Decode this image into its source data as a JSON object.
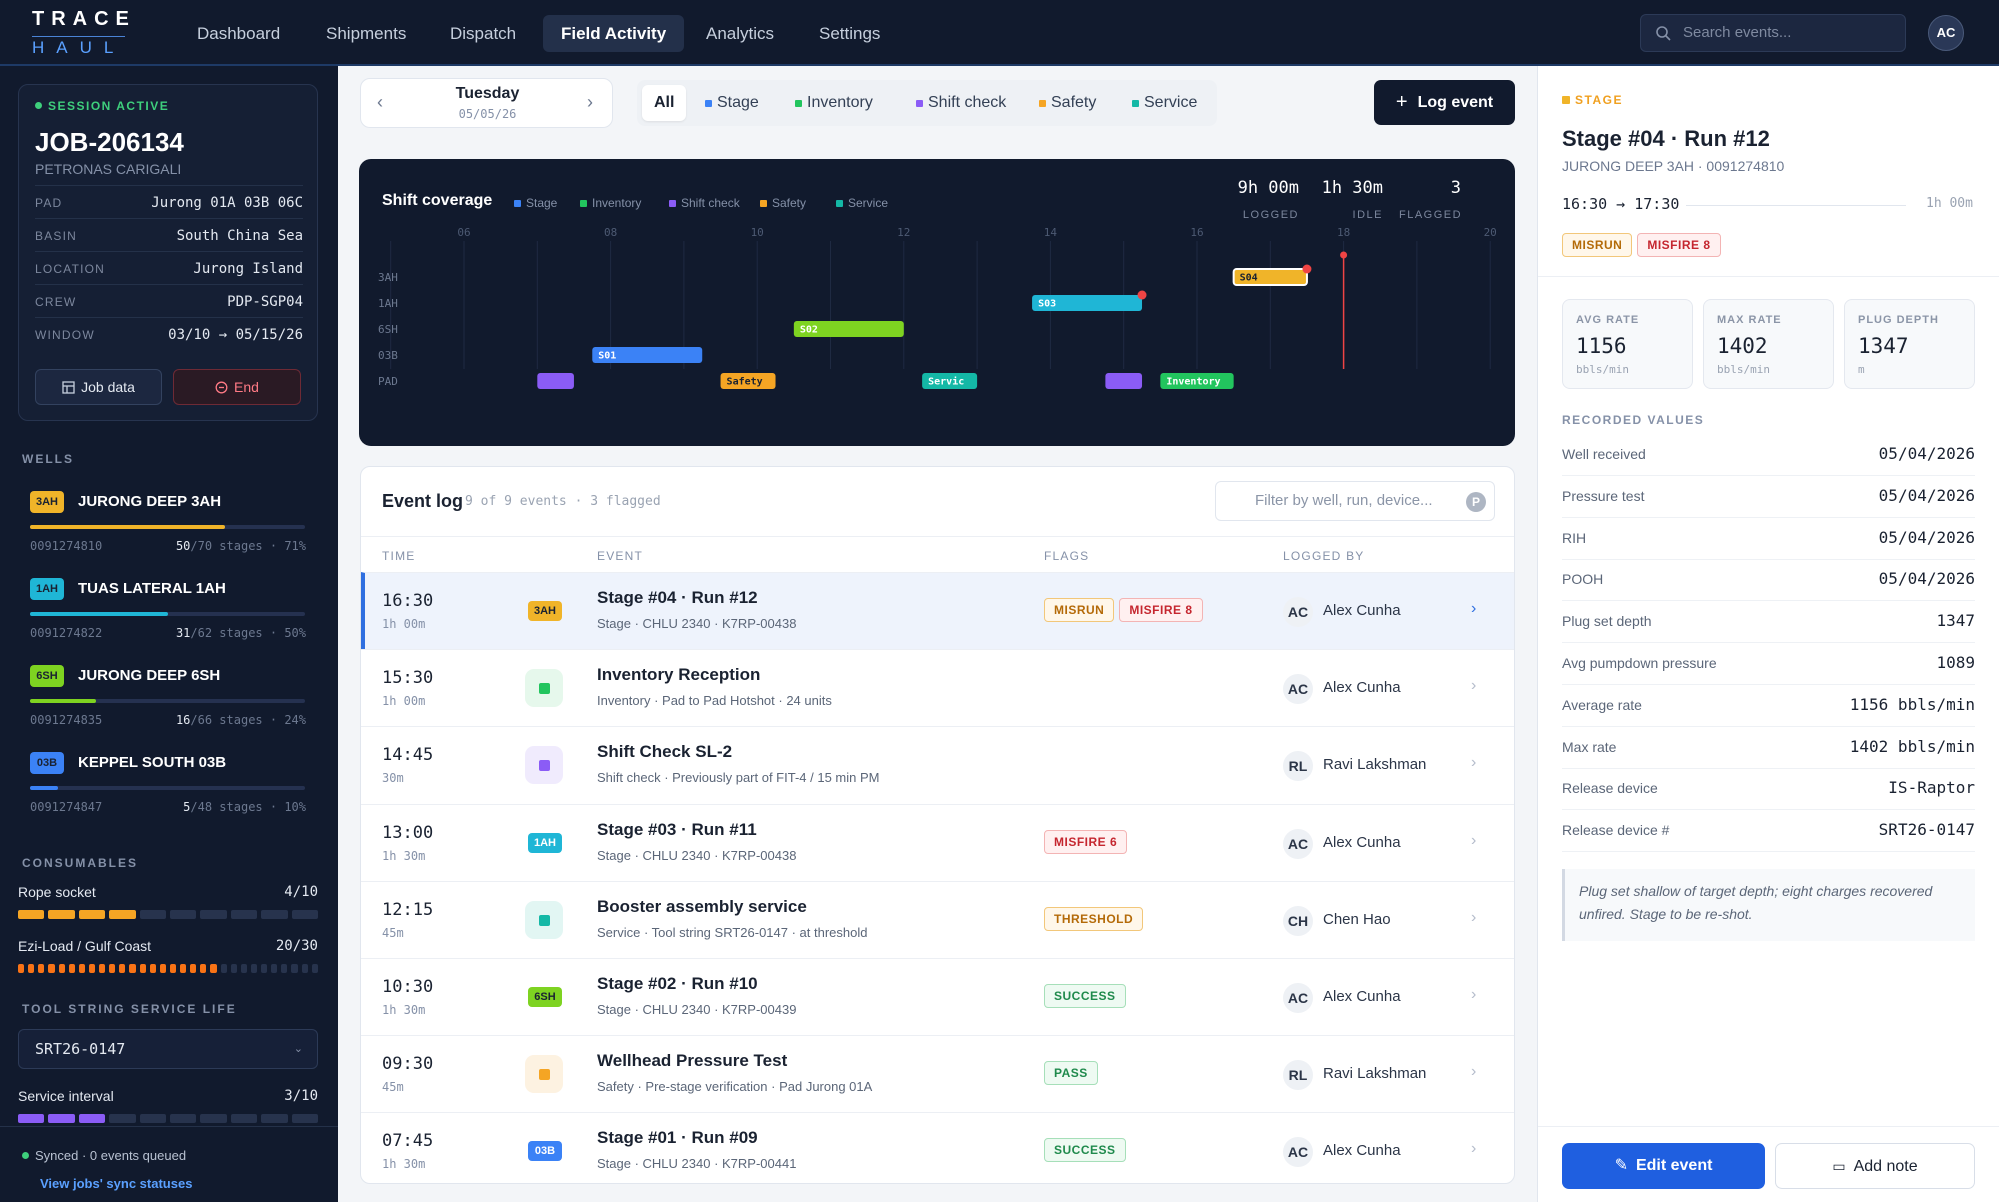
{
  "app": {
    "logo_top": "TRACE",
    "logo_bottom": "HAUL"
  },
  "nav": [
    "Dashboard",
    "Shipments",
    "Dispatch",
    "Field Activity",
    "Analytics",
    "Settings"
  ],
  "search": {
    "placeholder": "Search events..."
  },
  "user": {
    "initials": "AC"
  },
  "session": {
    "status": "SESSION ACTIVE",
    "job_id": "JOB-206134",
    "client": "PETRONAS CARIGALI",
    "fields": [
      {
        "k": "PAD",
        "v": "Jurong 01A 03B 06C"
      },
      {
        "k": "BASIN",
        "v": "South China Sea"
      },
      {
        "k": "LOCATION",
        "v": "Jurong Island"
      },
      {
        "k": "CREW",
        "v": "PDP-SGP04"
      },
      {
        "k": "WINDOW",
        "v": "03/10 → 05/15/26"
      }
    ],
    "job_data_label": "Job data",
    "end_label": "End"
  },
  "wells": {
    "heading": "WELLS",
    "items": [
      {
        "tag": "3AH",
        "name": "JURONG DEEP 3AH",
        "number": "0091274810",
        "done": "50",
        "total": "/70 stages · 71%",
        "progress": 0.71,
        "color": "#f0b429"
      },
      {
        "tag": "1AH",
        "name": "TUAS LATERAL 1AH",
        "number": "0091274822",
        "done": "31",
        "total": "/62 stages · 50%",
        "progress": 0.5,
        "color": "#1fb6d6"
      },
      {
        "tag": "6SH",
        "name": "JURONG DEEP 6SH",
        "number": "0091274835",
        "done": "16",
        "total": "/66 stages · 24%",
        "progress": 0.24,
        "color": "#7ed321"
      },
      {
        "tag": "03B",
        "name": "KEPPEL SOUTH 03B",
        "number": "0091274847",
        "done": "5",
        "total": "/48 stages · 10%",
        "progress": 0.1,
        "color": "#3b82f6"
      }
    ]
  },
  "consumables": {
    "heading": "CONSUMABLES",
    "items": [
      {
        "label": "Rope socket",
        "value": "4/10",
        "used": 4,
        "total": 10,
        "color": "#f5a524"
      },
      {
        "label": "Ezi-Load / Gulf Coast",
        "value": "20/30",
        "used": 20,
        "total": 30,
        "color": "#f97316"
      }
    ]
  },
  "toolstring": {
    "heading": "TOOL STRING SERVICE LIFE",
    "selected": "SRT26-0147",
    "interval_label": "Service interval",
    "interval_value": "3/10",
    "used": 3,
    "total": 10,
    "color": "#8b5cf6"
  },
  "sync": {
    "status": "Synced · 0 events queued",
    "link": "View jobs' sync statuses"
  },
  "datenav": {
    "day": "Tuesday",
    "date": "05/05/26"
  },
  "filters": [
    {
      "label": "All",
      "color": ""
    },
    {
      "label": "Stage",
      "color": "#3b82f6"
    },
    {
      "label": "Inventory",
      "color": "#22c55e"
    },
    {
      "label": "Shift check",
      "color": "#8b5cf6"
    },
    {
      "label": "Safety",
      "color": "#f5a524"
    },
    {
      "label": "Service",
      "color": "#14b8a6"
    }
  ],
  "log_event_label": "Log event",
  "chart_data": {
    "type": "timeline",
    "title": "Shift coverage",
    "legend": [
      {
        "name": "Stage",
        "color": "#3b82f6"
      },
      {
        "name": "Inventory",
        "color": "#22c55e"
      },
      {
        "name": "Shift check",
        "color": "#8b5cf6"
      },
      {
        "name": "Safety",
        "color": "#f5a524"
      },
      {
        "name": "Service",
        "color": "#14b8a6"
      }
    ],
    "stats": [
      {
        "value": "9h 00m",
        "label": "LOGGED"
      },
      {
        "value": "1h 30m",
        "label": "IDLE"
      },
      {
        "value": "3",
        "label": "FLAGGED"
      }
    ],
    "x_ticks": [
      "06",
      "08",
      "10",
      "12",
      "14",
      "16",
      "18",
      "20"
    ],
    "xlim": [
      5,
      20
    ],
    "rows": [
      "3AH",
      "1AH",
      "6SH",
      "03B",
      "PAD"
    ],
    "now": 18,
    "bars": [
      {
        "row": "3AH",
        "start": 16.5,
        "end": 17.5,
        "label": "S04",
        "color": "#f0b429",
        "selected": true,
        "flag": true
      },
      {
        "row": "1AH",
        "start": 13.75,
        "end": 15.25,
        "label": "S03",
        "color": "#1fb6d6",
        "flag": true
      },
      {
        "row": "6SH",
        "start": 10.5,
        "end": 12.0,
        "label": "S02",
        "color": "#7ed321"
      },
      {
        "row": "03B",
        "start": 7.75,
        "end": 9.25,
        "label": "S01",
        "color": "#3b82f6"
      },
      {
        "row": "PAD",
        "start": 7.0,
        "end": 7.5,
        "label": "",
        "color": "#8b5cf6"
      },
      {
        "row": "PAD",
        "start": 9.5,
        "end": 10.25,
        "label": "Safety",
        "color": "#f5a524"
      },
      {
        "row": "PAD",
        "start": 12.25,
        "end": 13.0,
        "label": "Servic",
        "color": "#14b8a6"
      },
      {
        "row": "PAD",
        "start": 14.75,
        "end": 15.25,
        "label": "",
        "color": "#8b5cf6"
      },
      {
        "row": "PAD",
        "start": 15.5,
        "end": 16.5,
        "label": "Inventory",
        "color": "#22c55e"
      }
    ]
  },
  "eventlog": {
    "title": "Event log",
    "count": "9 of 9 events · 3 flagged",
    "filter_placeholder": "Filter by well, run, device...",
    "columns": [
      "TIME",
      "EVENT",
      "FLAGS",
      "LOGGED BY"
    ],
    "rows": [
      {
        "time": "16:30",
        "dur": "1h 00m",
        "tag": "3AH",
        "tagcolor": "#f0b429",
        "title": "Stage #04 · Run #12",
        "sub": "Stage · CHLU 2340 · K7RP-00438",
        "flags": [
          {
            "t": "MISRUN",
            "c": "orange"
          },
          {
            "t": "MISFIRE 8",
            "c": "red"
          }
        ],
        "initials": "AC",
        "who": "Alex Cunha",
        "selected": true
      },
      {
        "time": "15:30",
        "dur": "1h 00m",
        "icon": "#22c55e",
        "iconbg": "#e6f8ec",
        "title": "Inventory Reception",
        "sub": "Inventory · Pad to Pad Hotshot · 24 units",
        "flags": [],
        "initials": "AC",
        "who": "Alex Cunha"
      },
      {
        "time": "14:45",
        "dur": "30m",
        "icon": "#8b5cf6",
        "iconbg": "#f0ebfd",
        "title": "Shift Check SL-2",
        "sub": "Shift check · Previously part of FIT-4 / 15 min PM",
        "flags": [],
        "initials": "RL",
        "who": "Ravi Lakshman"
      },
      {
        "time": "13:00",
        "dur": "1h 30m",
        "tag": "1AH",
        "tagcolor": "#1fb6d6",
        "title": "Stage #03 · Run #11",
        "sub": "Stage · CHLU 2340 · K7RP-00438",
        "flags": [
          {
            "t": "MISFIRE 6",
            "c": "red"
          }
        ],
        "initials": "AC",
        "who": "Alex Cunha"
      },
      {
        "time": "12:15",
        "dur": "45m",
        "icon": "#14b8a6",
        "iconbg": "#e2f6f3",
        "title": "Booster assembly service",
        "sub": "Service · Tool string SRT26-0147 · at threshold",
        "flags": [
          {
            "t": "THRESHOLD",
            "c": "orange"
          }
        ],
        "initials": "CH",
        "who": "Chen Hao"
      },
      {
        "time": "10:30",
        "dur": "1h 30m",
        "tag": "6SH",
        "tagcolor": "#7ed321",
        "title": "Stage #02 · Run #10",
        "sub": "Stage · CHLU 2340 · K7RP-00439",
        "flags": [
          {
            "t": "SUCCESS",
            "c": "green"
          }
        ],
        "initials": "AC",
        "who": "Alex Cunha"
      },
      {
        "time": "09:30",
        "dur": "45m",
        "icon": "#f5a524",
        "iconbg": "#fdf2e1",
        "title": "Wellhead Pressure Test",
        "sub": "Safety · Pre-stage verification · Pad Jurong 01A",
        "flags": [
          {
            "t": "PASS",
            "c": "green"
          }
        ],
        "initials": "RL",
        "who": "Ravi Lakshman"
      },
      {
        "time": "07:45",
        "dur": "1h 30m",
        "tag": "03B",
        "tagcolor": "#3b82f6",
        "title": "Stage #01 · Run #09",
        "sub": "Stage · CHLU 2340 · K7RP-00441",
        "flags": [
          {
            "t": "SUCCESS",
            "c": "green"
          }
        ],
        "initials": "AC",
        "who": "Alex Cunha"
      }
    ]
  },
  "detail": {
    "type": "STAGE",
    "title": "Stage #04 · Run #12",
    "subtitle": "JURONG DEEP 3AH · 0091274810",
    "timerange": "16:30 → 17:30",
    "duration": "1h 00m",
    "flags": [
      "MISRUN",
      "MISFIRE 8"
    ],
    "metrics": [
      {
        "label": "AVG RATE",
        "value": "1156",
        "unit": "bbls/min"
      },
      {
        "label": "MAX RATE",
        "value": "1402",
        "unit": "bbls/min"
      },
      {
        "label": "PLUG DEPTH",
        "value": "1347",
        "unit": "m"
      }
    ],
    "recorded_heading": "RECORDED VALUES",
    "recorded": [
      {
        "k": "Well received",
        "v": "05/04/2026"
      },
      {
        "k": "Pressure test",
        "v": "05/04/2026"
      },
      {
        "k": "RIH",
        "v": "05/04/2026"
      },
      {
        "k": "POOH",
        "v": "05/04/2026"
      },
      {
        "k": "Plug set depth",
        "v": "1347"
      },
      {
        "k": "Avg pumpdown pressure",
        "v": "1089"
      },
      {
        "k": "Average rate",
        "v": "1156 bbls/min"
      },
      {
        "k": "Max rate",
        "v": "1402 bbls/min"
      },
      {
        "k": "Release device",
        "v": "IS-Raptor"
      },
      {
        "k": "Release device #",
        "v": "SRT26-0147"
      }
    ],
    "note": "Plug set shallow of target depth; eight charges recovered unfired. Stage to be re-shot.",
    "edit_label": "Edit event",
    "note_label": "Add note"
  }
}
